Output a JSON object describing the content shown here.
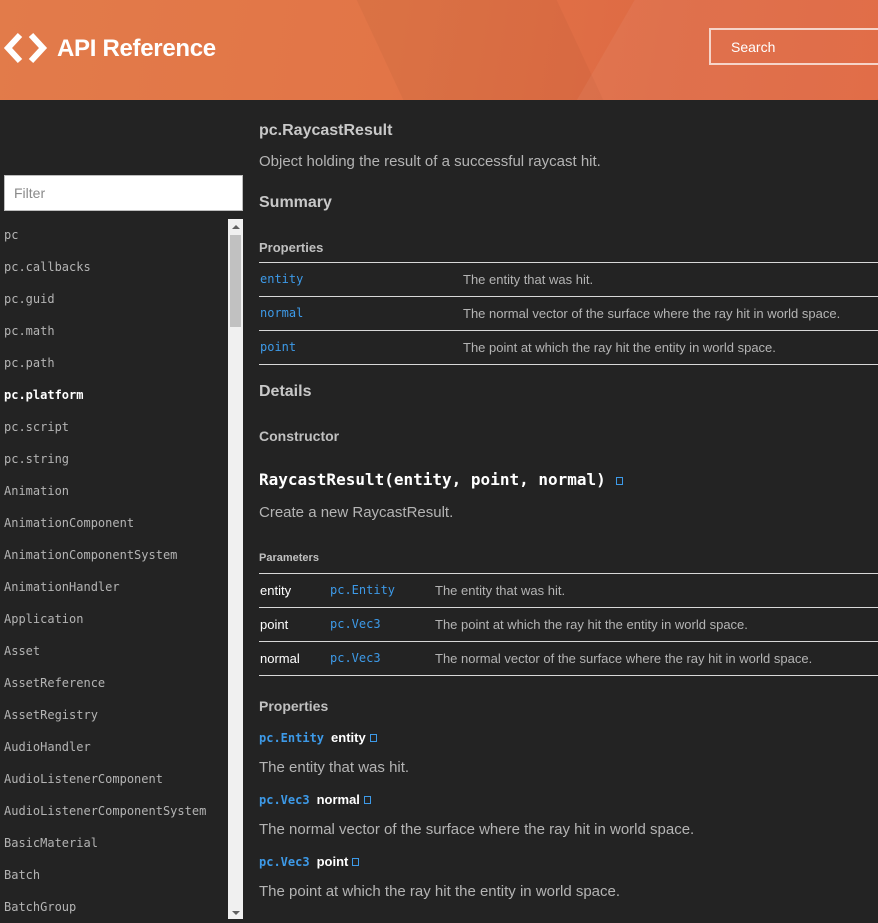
{
  "header": {
    "title": "API Reference",
    "search_placeholder": "Search"
  },
  "sidebar": {
    "filter_placeholder": "Filter",
    "items": [
      "pc",
      "pc.callbacks",
      "pc.guid",
      "pc.math",
      "pc.path",
      "pc.platform",
      "pc.script",
      "pc.string",
      "Animation",
      "AnimationComponent",
      "AnimationComponentSystem",
      "AnimationHandler",
      "Application",
      "Asset",
      "AssetReference",
      "AssetRegistry",
      "AudioHandler",
      "AudioListenerComponent",
      "AudioListenerComponentSystem",
      "BasicMaterial",
      "Batch",
      "BatchGroup"
    ],
    "active_item": "pc.platform"
  },
  "main": {
    "class_name": "pc.RaycastResult",
    "class_description": "Object holding the result of a successful raycast hit.",
    "summary_heading": "Summary",
    "properties_heading": "Properties",
    "summary_properties": [
      {
        "name": "entity",
        "description": "The entity that was hit."
      },
      {
        "name": "normal",
        "description": "The normal vector of the surface where the ray hit in world space."
      },
      {
        "name": "point",
        "description": "The point at which the ray hit the entity in world space."
      }
    ],
    "details_heading": "Details",
    "constructor_heading": "Constructor",
    "constructor_signature": "RaycastResult(entity, point, normal)",
    "constructor_description": "Create a new RaycastResult.",
    "parameters_heading": "Parameters",
    "parameters": [
      {
        "name": "entity",
        "type": "pc.Entity",
        "description": "The entity that was hit."
      },
      {
        "name": "point",
        "type": "pc.Vec3",
        "description": "The point at which the ray hit the entity in world space."
      },
      {
        "name": "normal",
        "type": "pc.Vec3",
        "description": "The normal vector of the surface where the ray hit in world space."
      }
    ],
    "details_properties_heading": "Properties",
    "details_properties": [
      {
        "type": "pc.Entity",
        "name": "entity",
        "description": "The entity that was hit."
      },
      {
        "type": "pc.Vec3",
        "name": "normal",
        "description": "The normal vector of the surface where the ray hit in world space."
      },
      {
        "type": "pc.Vec3",
        "name": "point",
        "description": "The point at which the ray hit the entity in world space."
      }
    ]
  },
  "colors": {
    "header_orange": "#e27547",
    "background": "#232323",
    "link_blue": "#3d9ae8"
  }
}
